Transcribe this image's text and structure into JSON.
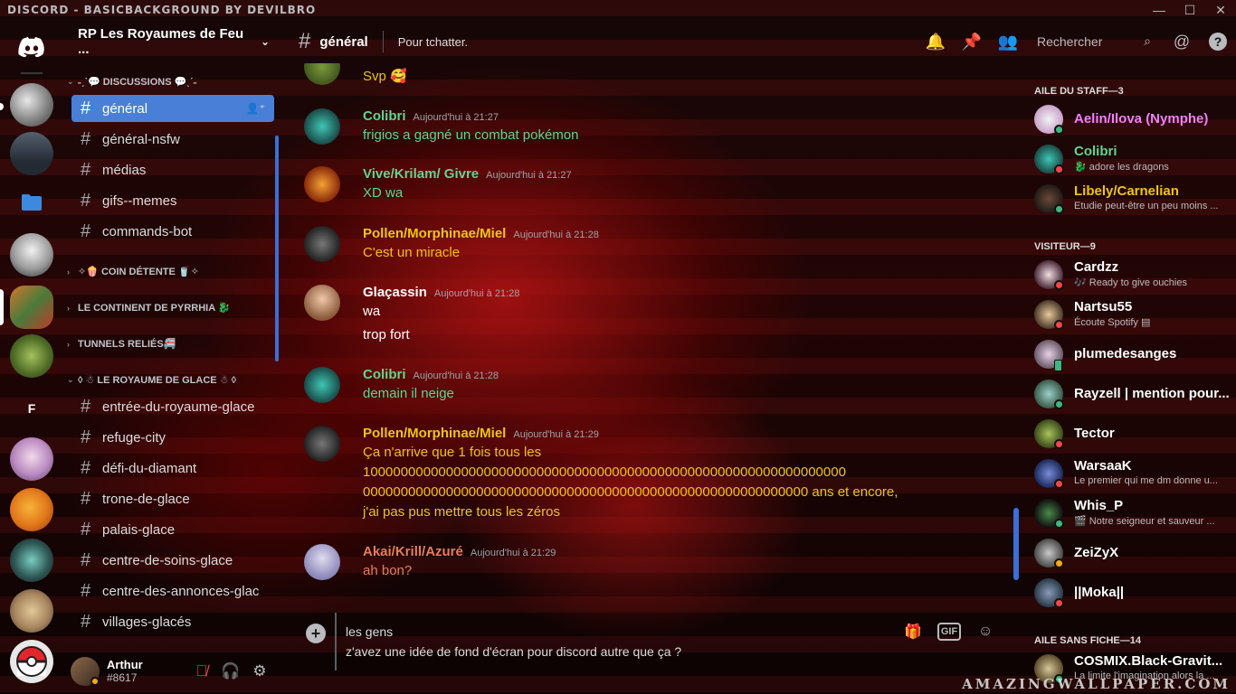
{
  "window": {
    "title": "DISCORD - BASICBACKGROUND BY DEVILBRO",
    "controls": [
      "—",
      "☐",
      "✕"
    ]
  },
  "guilds": [
    {
      "label": "",
      "color": "#5865f2",
      "icon": "discord-logo-icon"
    },
    {
      "label": "",
      "color": "#9a9a9a"
    },
    {
      "label": "",
      "color": "#3c4656"
    },
    {
      "label": "",
      "color": "#2f7bd2",
      "icon": "folder-icon"
    },
    {
      "label": "",
      "color": "#d0d0d0"
    },
    {
      "label": "",
      "color": "#b96b2d"
    },
    {
      "label": "",
      "color": "#5f7d2b"
    },
    {
      "label": "F",
      "color": "#000000"
    },
    {
      "label": "",
      "color": "#c9a2c9"
    },
    {
      "label": "",
      "color": "#e8801c"
    },
    {
      "label": "",
      "color": "#2f5a57"
    },
    {
      "label": "",
      "color": "#a8865f"
    },
    {
      "label": "",
      "color": "#e8e8e8"
    }
  ],
  "server": {
    "name": "RP Les Royaumes de Feu ...",
    "chevron": "⌄"
  },
  "categories": {
    "discussions": "˗ˏˋ💬 DISCUSSIONS 💬ˎˊ˗",
    "detente": "✧🍿 COIN DÉTENTE 🥤✧",
    "pyrrhia": "LE CONTINENT DE PYRRHIA 🐉",
    "tunnels": "TUNNELS RELIÉS🚝",
    "glace": "◊ ☃ LE ROYAUME DE GLACE ☃ ◊"
  },
  "channels_top": [
    "général",
    "général-nsfw",
    "médias",
    "gifs--memes",
    "commands-bot"
  ],
  "channels_glace": [
    "entrée-du-royaume-glace",
    "refuge-city",
    "défi-du-diamant",
    "trone-de-glace",
    "palais-glace",
    "centre-de-soins-glace",
    "centre-des-annonces-glac",
    "villages-glacés"
  ],
  "user": {
    "name": "Arthur",
    "tag": "#8617"
  },
  "header": {
    "channel": "général",
    "topic": "Pour tchatter.",
    "search_placeholder": "Rechercher"
  },
  "messages": [
    {
      "author": "",
      "time": "",
      "lines": [
        "Svp 🥰"
      ],
      "color": "#f1c40f"
    },
    {
      "author": "Colibri",
      "time": "Aujourd'hui à 21:27",
      "lines": [
        "frigios a gagné un combat pokémon"
      ],
      "color": "#5fd68f"
    },
    {
      "author": "Vive/Krilam/ Givre",
      "time": "Aujourd'hui à 21:27",
      "lines": [
        "XD wa"
      ],
      "color": "#5fd68f"
    },
    {
      "author": "Pollen/Morphinae/Miel",
      "time": "Aujourd'hui à 21:28",
      "lines": [
        "C'est un miracle"
      ],
      "color": "#f1c40f"
    },
    {
      "author": "Glaçassin",
      "time": "Aujourd'hui à 21:28",
      "lines": [
        "wa",
        "trop fort"
      ],
      "color": "#ffffff"
    },
    {
      "author": "Colibri",
      "time": "Aujourd'hui à 21:28",
      "lines": [
        "demain il neige"
      ],
      "color": "#5fd68f"
    },
    {
      "author": "Pollen/Morphinae/Miel",
      "time": "Aujourd'hui à 21:29",
      "lines": [
        "Ça n'arrive que 1 fois tous les",
        "1000000000000000000000000000000000000000000000000000000000000000",
        "00000000000000000000000000000000000000000000000000000000000 ans et encore,",
        "j'ai pas pus mettre tous les zéros"
      ],
      "color": "#f1c40f"
    },
    {
      "author": "Akai/Krill/Azuré",
      "time": "Aujourd'hui à 21:29",
      "lines": [
        "ah bon?"
      ],
      "color": "#e67e5a"
    }
  ],
  "composer": {
    "lines": [
      "les gens",
      "z'avez une idée de fond d'écran pour discord autre que ça ?"
    ],
    "gif": "GIF"
  },
  "member_groups": [
    {
      "title": "AILE DU STAFF—3",
      "members": [
        {
          "name": "Aelin/Ilova (Nymphe)",
          "status": "",
          "color": "#f47fff",
          "presence": "online"
        },
        {
          "name": "Colibri",
          "status": "🐉 adore les dragons",
          "color": "#5fd68f",
          "presence": "dnd"
        },
        {
          "name": "Libely/Carnelian",
          "status": "Etudie peut-être un peu moins ...",
          "color": "#f1c40f",
          "presence": "online"
        }
      ]
    },
    {
      "title": "VISITEUR—9",
      "members": [
        {
          "name": "Cardzz",
          "status": "🎶 Ready to give ouchies",
          "color": "#ffffff",
          "presence": "dnd"
        },
        {
          "name": "Nartsu55",
          "status": "Écoute Spotify",
          "color": "#ffffff",
          "presence": "dnd"
        },
        {
          "name": "plumedesanges",
          "status": "",
          "color": "#ffffff",
          "presence": "mobile"
        },
        {
          "name": "Rayzell | mention pour...",
          "status": "",
          "color": "#ffffff",
          "presence": "online"
        },
        {
          "name": "Tector",
          "status": "",
          "color": "#ffffff",
          "presence": "dnd"
        },
        {
          "name": "WarsaaK",
          "status": "Le premier qui me dm donne u...",
          "color": "#ffffff",
          "presence": "dnd"
        },
        {
          "name": "Whis_P",
          "status": "🎬 Notre seigneur et sauveur ...",
          "color": "#ffffff",
          "presence": "online"
        },
        {
          "name": "ZeiZyX",
          "status": "",
          "color": "#ffffff",
          "presence": "idle"
        },
        {
          "name": "||Moka||",
          "status": "",
          "color": "#ffffff",
          "presence": "dnd"
        }
      ]
    },
    {
      "title": "AILE SANS FICHE—14",
      "members": [
        {
          "name": "COSMIX.Black-Gravit...",
          "status": "La limite l'imagination alors la ...",
          "color": "#ffffff",
          "presence": "online"
        }
      ]
    }
  ],
  "watermark": "AMAZINGWALLPAPER.COM"
}
